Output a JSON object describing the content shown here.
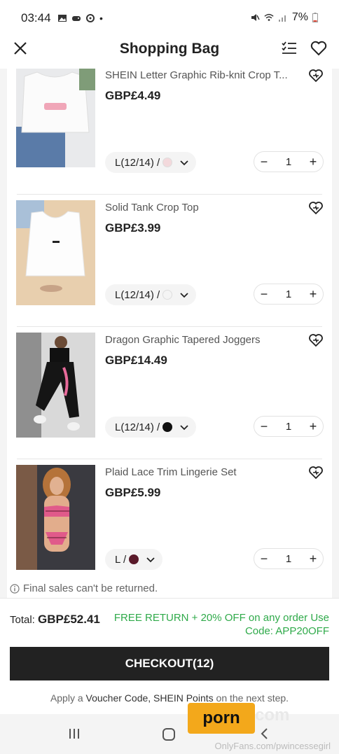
{
  "status_bar": {
    "time": "03:44",
    "battery": "7%",
    "dot": "•"
  },
  "header": {
    "title": "Shopping Bag"
  },
  "items": [
    {
      "title": "SHEIN Letter Graphic Rib-knit Crop T...",
      "price": "GBP£4.49",
      "variant": "L(12/14) /",
      "swatch_color": "#f3d9dc",
      "quantity": "1"
    },
    {
      "title": "Solid Tank Crop Top",
      "price": "GBP£3.99",
      "variant": "L(12/14) /",
      "swatch_color": "#f4f4f4",
      "quantity": "1"
    },
    {
      "title": "Dragon Graphic Tapered Joggers",
      "price": "GBP£14.49",
      "variant": "L(12/14) /",
      "swatch_color": "#111111",
      "quantity": "1"
    },
    {
      "title": "Plaid Lace Trim Lingerie Set",
      "price": "GBP£5.99",
      "variant": "L /",
      "swatch_color": "#5a1a2a",
      "quantity": "1"
    }
  ],
  "final_sales_note": "Final sales can't be returned.",
  "footer": {
    "total_label": "Total:",
    "total_value": "GBP£52.41",
    "promo": "FREE RETURN + 20% OFF on any order Use Code: APP20OFF",
    "checkout_label": "CHECKOUT(12)",
    "voucher_prefix": "Apply a",
    "voucher_mid": "Voucher Code, SHEIN Points",
    "voucher_suffix": "on the next step."
  },
  "watermark": {
    "logo_text": "porn",
    "ghost_text": "com",
    "credit": "OnlyFans.com/pwincessegirl"
  },
  "colors": {
    "accent_green": "#2faa4a",
    "checkout_bg": "#222222"
  }
}
